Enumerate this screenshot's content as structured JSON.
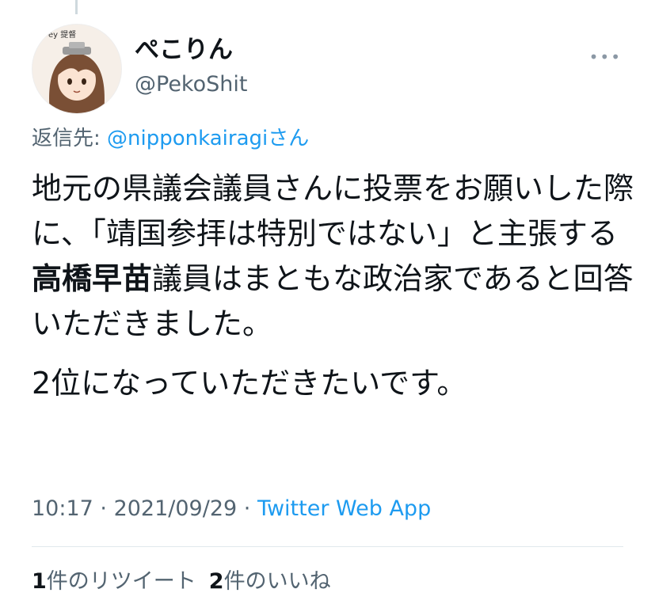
{
  "user": {
    "display_name": "ぺこりん",
    "handle": "@PekoShit",
    "avatar_caption": "ey 提督"
  },
  "more_icon": "more-horizontal-icon",
  "reply": {
    "prefix": "返信先: ",
    "target": "@nipponkairagi",
    "suffix": "さん"
  },
  "tweet": {
    "para1_a": "地元の県議会議員さんに投票をお願いした際に、「靖国参拝は特別ではない」と主張する",
    "para1_bold": "高橋早苗",
    "para1_b": "議員はまともな政治家であると回答いただきました。",
    "para2": "2位になっていただきたいです。"
  },
  "meta": {
    "time": "10:17",
    "date": "2021/09/29",
    "separator": " · ",
    "app": "Twitter Web App"
  },
  "stats": {
    "retweets_count": "1",
    "retweets_label": "件のリツイート",
    "likes_count": "2",
    "likes_label": "件のいいね"
  }
}
